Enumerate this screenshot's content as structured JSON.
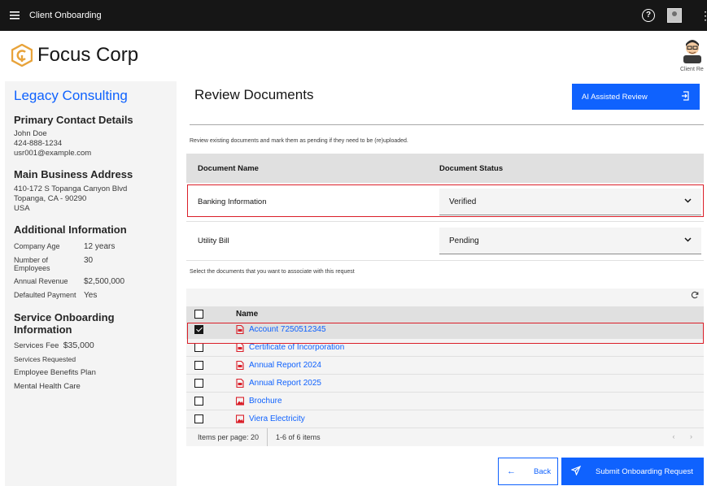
{
  "topbar": {
    "app_title": "Client Onboarding",
    "menu_icon": "hamburger-icon",
    "help_icon": "help-icon",
    "kebab": "⋮"
  },
  "brand": {
    "name": "Focus Corp",
    "avatar_label": "Client Re"
  },
  "sidebar": {
    "company": "Legacy Consulting",
    "primary_title": "Primary Contact Details",
    "contact_name": "John Doe",
    "contact_phone": "424-888-1234",
    "contact_email": "usr001@example.com",
    "address_title": "Main Business Address",
    "address_line1": "410-172 S Topanga Canyon Blvd",
    "address_line2": "Topanga, CA - 90290",
    "address_line3": "USA",
    "additional_title": "Additional Information",
    "additional": [
      {
        "k": "Company Age",
        "v": "12 years"
      },
      {
        "k": "Number of Employees",
        "v": "30"
      },
      {
        "k": "Annual Revenue",
        "v": "$2,500,000"
      },
      {
        "k": "Defaulted Payment",
        "v": "Yes"
      }
    ],
    "service_title": "Service Onboarding Information",
    "services_fee_label": "Services Fee",
    "services_fee_value": "$35,000",
    "services_requested_label": "Services Requested",
    "services": [
      "Employee Benefits Plan",
      "Mental Health Care"
    ]
  },
  "main": {
    "title": "Review Documents",
    "ai_button": "AI Assisted Review",
    "instructions": "Review existing documents and mark them as pending if they need to be (re)uploaded.",
    "doc_headers": [
      "Document Name",
      "Document Status"
    ],
    "docs": [
      {
        "name": "Banking Information",
        "status": "Verified"
      },
      {
        "name": "Utility Bill",
        "status": "Pending"
      }
    ],
    "select_instructions": "Select the documents that you want to associate with this request",
    "file_header": "Name",
    "files": [
      {
        "name": "Account 7250512345",
        "type": "pdf",
        "checked": true
      },
      {
        "name": "Certificate of Incorporation",
        "type": "pdf",
        "checked": false
      },
      {
        "name": "Annual Report 2024",
        "type": "pdf",
        "checked": false
      },
      {
        "name": "Annual Report 2025",
        "type": "pdf",
        "checked": false
      },
      {
        "name": "Brochure",
        "type": "image",
        "checked": false
      },
      {
        "name": "Viera Electricity",
        "type": "image",
        "checked": false
      }
    ],
    "pager_per_page": "Items per page: 20",
    "pager_range": "1-6 of 6 items",
    "back_button": "Back",
    "submit_button": "Submit Onboarding Request"
  },
  "colors": {
    "accent": "#0f62fe",
    "topbar": "#161616",
    "highlight": "#da1e28",
    "pdf_icon": "#da1e28",
    "brand_logo": "#e8a33a"
  }
}
